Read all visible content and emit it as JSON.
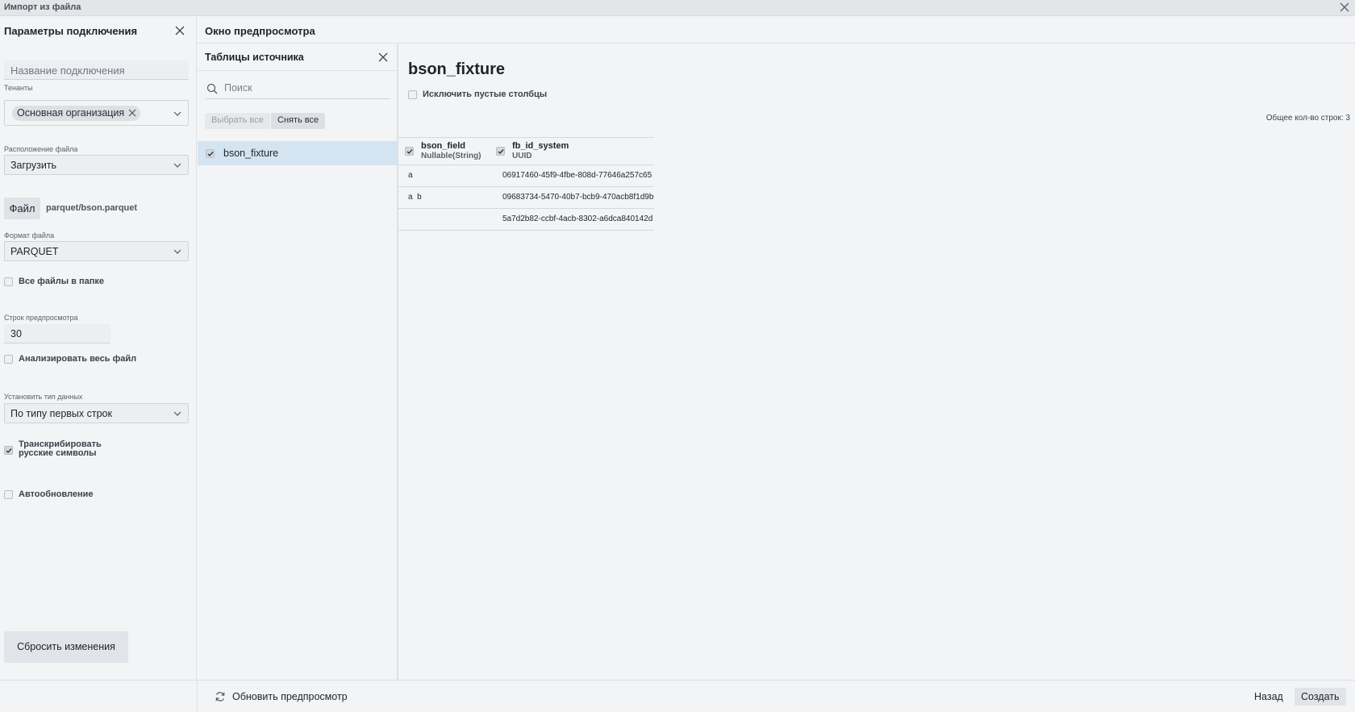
{
  "window": {
    "title": "Импорт из файла"
  },
  "connection": {
    "header": "Параметры подключения",
    "name_placeholder": "Название подключения",
    "tenants_label": "Тенанты",
    "tenant_chip": "Основная организация",
    "file_location_label": "Расположение файла",
    "file_location_value": "Загрузить",
    "file_button": "Файл",
    "file_path": "parquet/bson.parquet",
    "file_format_label": "Формат файла",
    "file_format_value": "PARQUET",
    "all_files_label": "Все файлы в папке",
    "preview_rows_label": "Строк предпросмотра",
    "preview_rows_value": "30",
    "analyze_label": "Анализировать весь файл",
    "data_type_label": "Установить тип данных",
    "data_type_value": "По типу первых строк",
    "transcribe_label_1": "Транскрибировать",
    "transcribe_label_2": "русские символы",
    "autoupdate_label": "Автообновление",
    "reset_button": "Сбросить изменения"
  },
  "preview": {
    "header": "Окно предпросмотра",
    "sources": {
      "header": "Таблицы источника",
      "search_placeholder": "Поиск",
      "select_all": "Выбрать все",
      "deselect_all": "Снять все",
      "items": [
        {
          "label": "bson_fixture",
          "checked": true
        }
      ]
    },
    "table": {
      "title": "bson_fixture",
      "exclude_empty_label": "Исключить пустые столбцы",
      "row_count": "Общее кол-во строк: 3",
      "columns": [
        {
          "name": "bson_field",
          "type": "Nullable(String)"
        },
        {
          "name": "fb_id_system",
          "type": "UUID"
        }
      ],
      "rows": [
        [
          "a",
          "06917460-45f9-4fbe-808d-77646a257c65"
        ],
        [
          "a  b",
          "09683734-5470-40b7-bcb9-470acb8f1d9b"
        ],
        [
          "",
          "5a7d2b82-ccbf-4acb-8302-a6dca840142d"
        ]
      ]
    }
  },
  "footer": {
    "refresh": "Обновить предпросмотр",
    "back": "Назад",
    "create": "Создать"
  }
}
